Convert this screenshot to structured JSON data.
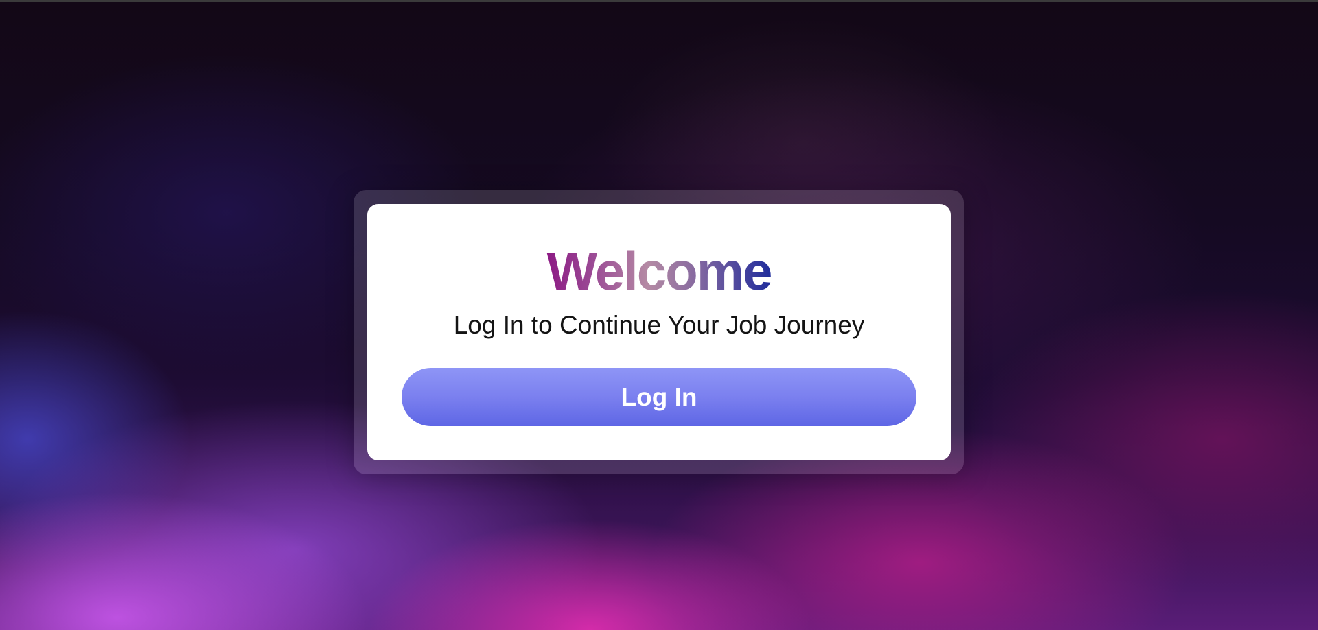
{
  "login_card": {
    "title": "Welcome",
    "subtitle": "Log In to Continue Your Job Journey",
    "login_button_label": "Log In"
  },
  "colors": {
    "button_gradient_top": "#8e95f6",
    "button_gradient_bottom": "#5e66e5",
    "title_gradient_start": "#8c1a84",
    "title_gradient_end": "#1f2c9c",
    "card_background": "#ffffff"
  }
}
